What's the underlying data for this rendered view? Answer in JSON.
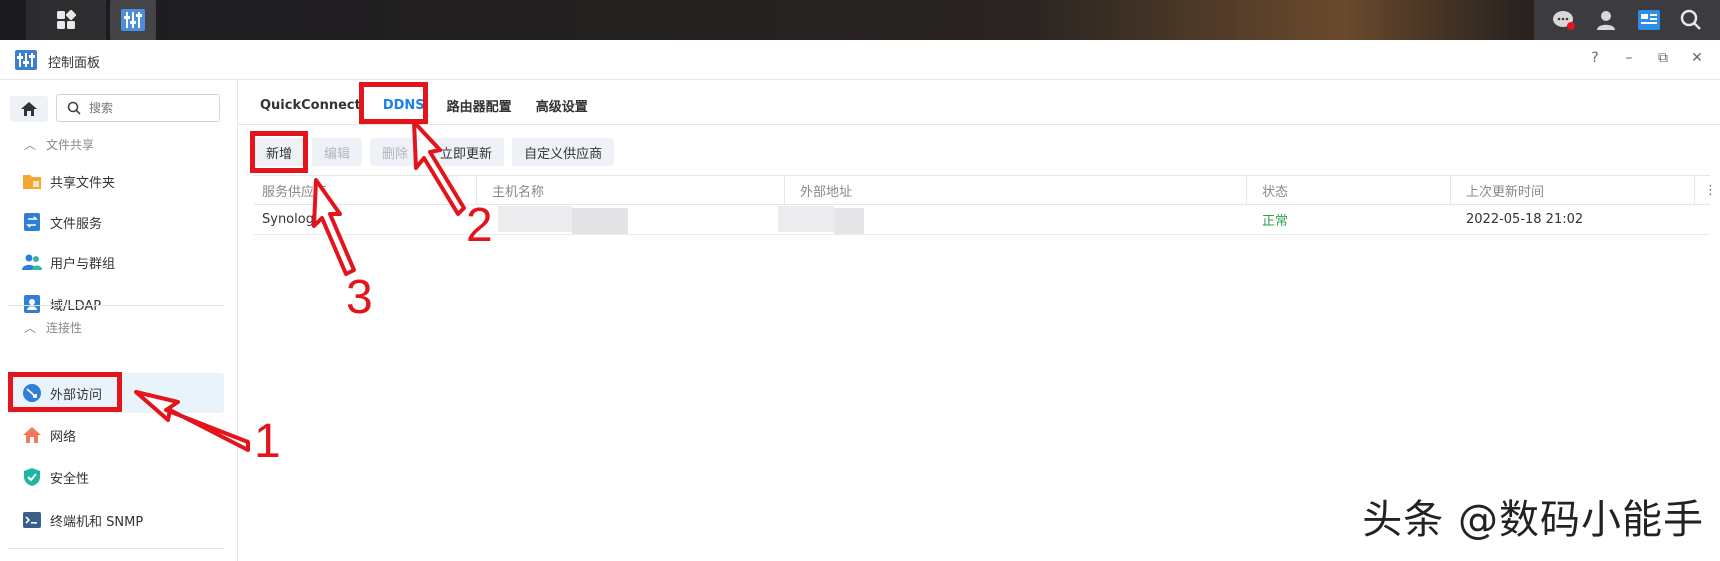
{
  "window": {
    "title": "控制面板"
  },
  "window_controls": {
    "help": "?",
    "minimize": "–",
    "restore": "⧉",
    "close": "✕"
  },
  "sidebar": {
    "search_placeholder": "搜索",
    "sections": [
      {
        "title": "文件共享",
        "items": [
          "共享文件夹",
          "文件服务",
          "用户与群组",
          "域/LDAP"
        ]
      },
      {
        "title": "连接性",
        "items": [
          "外部访问",
          "网络",
          "安全性",
          "终端机和 SNMP"
        ]
      }
    ],
    "active_item": "外部访问"
  },
  "tabs": [
    "QuickConnect",
    "DDNS",
    "路由器配置",
    "高级设置"
  ],
  "active_tab": "DDNS",
  "toolbar": {
    "add": "新增",
    "edit": "编辑",
    "delete": "删除",
    "update_now": "立即更新",
    "custom_provider": "自定义供应商"
  },
  "table": {
    "columns": [
      "服务供应商",
      "主机名称",
      "外部地址",
      "状态",
      "上次更新时间"
    ],
    "rows": [
      {
        "provider": "Synology",
        "hostname": "",
        "external_address": "",
        "status": "正常",
        "last_update": "2022-05-18 21:02"
      }
    ]
  },
  "annotations": {
    "step1": "1",
    "step2": "2",
    "step3": "3"
  },
  "watermark": "头条 @数码小能手",
  "colors": {
    "annotation_red": "#e3141c",
    "accent_blue": "#1a82e2",
    "status_green": "#2ba24c"
  }
}
